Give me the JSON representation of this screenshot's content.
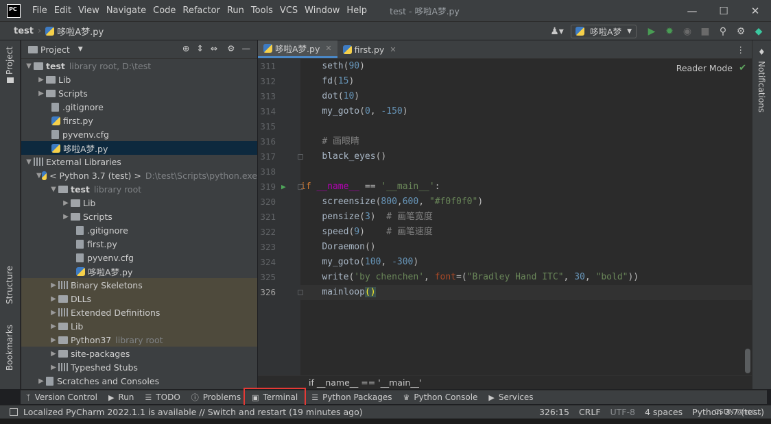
{
  "app": {
    "logo": "PC",
    "window_title": "test - 哆啦A梦.py",
    "menu": [
      "File",
      "Edit",
      "View",
      "Navigate",
      "Code",
      "Refactor",
      "Run",
      "Tools",
      "VCS",
      "Window",
      "Help"
    ]
  },
  "navbar": {
    "project": "test",
    "file": "哆啦A梦.py",
    "run_config": "哆啦A梦"
  },
  "left_strip": {
    "project_label": "Project",
    "structure_label": "Structure",
    "bookmarks_label": "Bookmarks"
  },
  "right_strip": {
    "notifications_label": "Notifications"
  },
  "project_panel": {
    "title": "Project",
    "tree": [
      {
        "label": "test",
        "extra": "library root,  D:\\test",
        "bold": true
      },
      {
        "label": "Lib"
      },
      {
        "label": "Scripts"
      },
      {
        "label": ".gitignore"
      },
      {
        "label": "first.py"
      },
      {
        "label": "pyvenv.cfg"
      },
      {
        "label": "哆啦A梦.py"
      },
      {
        "label": "External Libraries"
      },
      {
        "label": "< Python 3.7 (test) >",
        "extra": "D:\\test\\Scripts\\python.exe"
      },
      {
        "label": "test",
        "extra": "library root",
        "bold": true
      },
      {
        "label": "Lib"
      },
      {
        "label": "Scripts"
      },
      {
        "label": ".gitignore"
      },
      {
        "label": "first.py"
      },
      {
        "label": "pyvenv.cfg"
      },
      {
        "label": "哆啦A梦.py"
      },
      {
        "label": "Binary Skeletons"
      },
      {
        "label": "DLLs"
      },
      {
        "label": "Extended Definitions"
      },
      {
        "label": "Lib"
      },
      {
        "label": "Python37",
        "extra": "library root"
      },
      {
        "label": "site-packages"
      },
      {
        "label": "Typeshed Stubs"
      },
      {
        "label": "Scratches and Consoles"
      }
    ]
  },
  "editor": {
    "tabs": [
      "哆啦A梦.py",
      "first.py"
    ],
    "reader_mode": "Reader Mode",
    "line_numbers": [
      "311",
      "312",
      "313",
      "314",
      "315",
      "316",
      "317",
      "318",
      "319",
      "320",
      "321",
      "322",
      "323",
      "324",
      "325",
      "326"
    ],
    "breadcrumb": "if __name__ == '__main__'"
  },
  "tool_windows": [
    "Version Control",
    "Run",
    "TODO",
    "Problems",
    "Terminal",
    "Python Packages",
    "Python Console",
    "Services"
  ],
  "status_bar": {
    "message": "Localized PyCharm 2022.1.1 is available // Switch and restart (19 minutes ago)",
    "position": "326:15",
    "line_sep": "CRLF",
    "encoding": "UTF-8",
    "indent": "4 spaces",
    "interpreter": "Python 3.7 (test)"
  },
  "watermark": "CSDN @ncc..."
}
